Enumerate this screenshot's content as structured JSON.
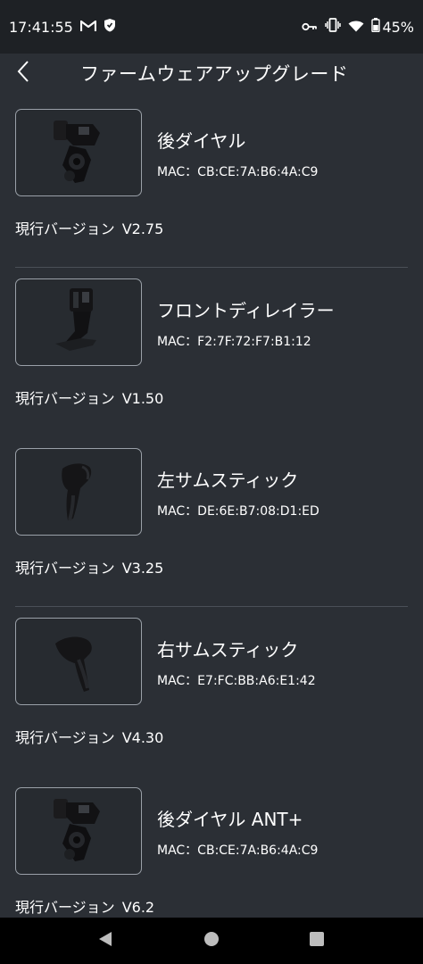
{
  "status_bar": {
    "time": "17:41:55",
    "battery": "45%",
    "icons": [
      "gmail-icon",
      "shield-icon",
      "key-icon",
      "vibrate-icon",
      "wifi-icon",
      "battery-icon"
    ]
  },
  "header": {
    "title": "ファームウェアアップグレード",
    "back_icon": "chevron-left-icon"
  },
  "version_label": "現行バージョン",
  "devices": [
    {
      "name": "後ダイヤル",
      "mac": "MAC：CB:CE:7A:B6:4A:C9",
      "version": "V2.75",
      "icon": "rear-derailleur-image"
    },
    {
      "name": "フロントディレイラー",
      "mac": "MAC：F2:7F:72:F7:B1:12",
      "version": "V1.50",
      "icon": "front-derailleur-image"
    },
    {
      "name": "左サムスティック",
      "mac": "MAC：DE:6E:B7:08:D1:ED",
      "version": "V3.25",
      "icon": "left-shifter-image"
    },
    {
      "name": "右サムスティック",
      "mac": "MAC：E7:FC:BB:A6:E1:42",
      "version": "V4.30",
      "icon": "right-shifter-image"
    },
    {
      "name": "後ダイヤル ANT+",
      "mac": "MAC：CB:CE:7A:B6:4A:C9",
      "version": "V6.2",
      "icon": "rear-derailleur-image"
    }
  ],
  "nav_bar": {
    "icons": [
      "back-icon",
      "home-icon",
      "recents-icon"
    ]
  },
  "colors": {
    "background": "#2b2f35",
    "status_bar": "#1e2125",
    "nav_bar": "#000000",
    "text": "#ffffff",
    "border": "#9aa0a8"
  }
}
